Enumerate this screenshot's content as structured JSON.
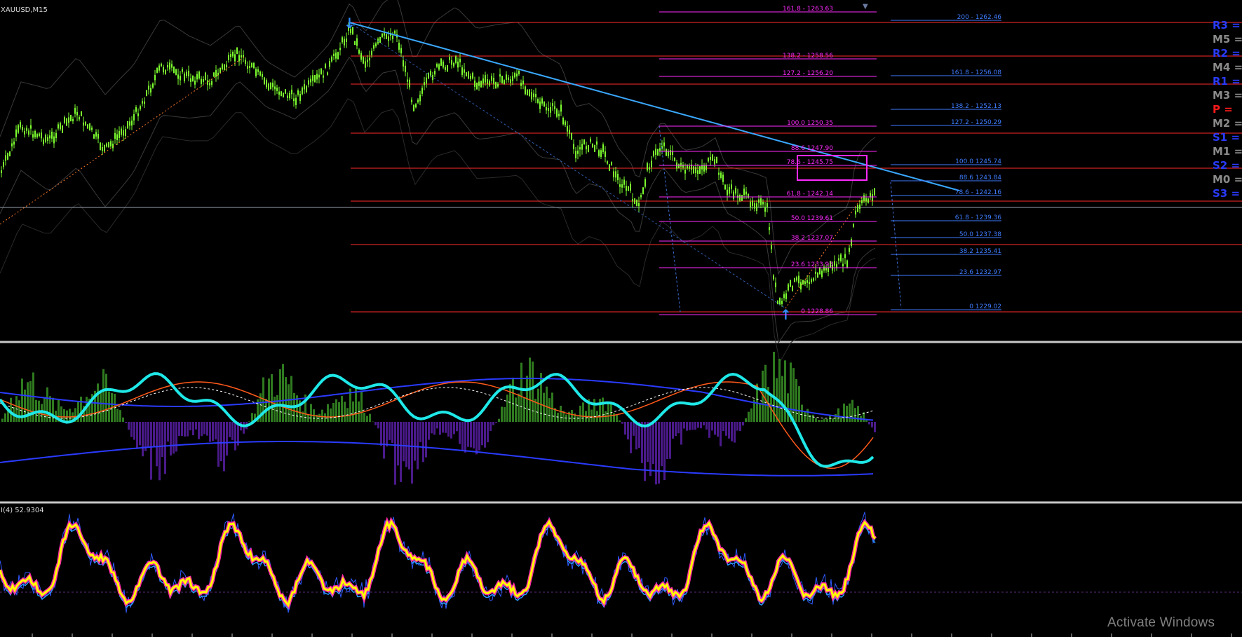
{
  "window": {
    "symbol_label": "XAUUSD,M15",
    "indicator_label": "I(4) 52.9304",
    "watermark": "Activate Windows"
  },
  "colors": {
    "background": "#000000",
    "candle": "#7CFF2F",
    "red_line": "#ff2a2a",
    "fib_magenta": "#ff2aff",
    "fib_blue": "#3f7dff",
    "trend_line": "#3aa8ff",
    "cyan": "#1fe8e8",
    "pivot_blue": "#2a3bff",
    "pivot_gray": "#8a8a8a",
    "pivot_red": "#ff1a1a",
    "hist_green": "#2f7a1f",
    "hist_purple": "#4a1a8a",
    "osc_yellow": "#ffff00",
    "osc_magenta": "#ff2aa8"
  },
  "fib_left": [
    {
      "label": "161.8 - 1263.63"
    },
    {
      "label": "138.2 - 1258.56"
    },
    {
      "label": "127.2 - 1256.20"
    },
    {
      "label": "100.0 1250.35"
    },
    {
      "label": "88.6 1247.90"
    },
    {
      "label": "78.6 - 1245.75"
    },
    {
      "label": "61.8 - 1242.14"
    },
    {
      "label": "50.0 1239.61"
    },
    {
      "label": "38.2 1237.07"
    },
    {
      "label": "23.6 1233.93"
    },
    {
      "label": "0 1228.86"
    }
  ],
  "fib_right": [
    {
      "label": "200 - 1262.46"
    },
    {
      "label": "161.8 - 1256.08"
    },
    {
      "label": "138.2 - 1252.13"
    },
    {
      "label": "127.2 - 1250.29"
    },
    {
      "label": "100.0 1245.74"
    },
    {
      "label": "88.6 1243.84"
    },
    {
      "label": "78.6 - 1242.16"
    },
    {
      "label": "61.8 - 1239.36"
    },
    {
      "label": "50.0 1237.38"
    },
    {
      "label": "38.2 1235.41"
    },
    {
      "label": "23.6 1232.97"
    },
    {
      "label": "0 1229.02"
    }
  ],
  "pivots": [
    {
      "label": "R3 = ",
      "color": "blue"
    },
    {
      "label": "M5 = ",
      "color": "gray"
    },
    {
      "label": "R2 = ",
      "color": "blue"
    },
    {
      "label": "M4 = ",
      "color": "gray"
    },
    {
      "label": "R1 = ",
      "color": "blue"
    },
    {
      "label": "M3 = ",
      "color": "gray"
    },
    {
      "label": "P  = ",
      "color": "red"
    },
    {
      "label": "M2 = ",
      "color": "gray"
    },
    {
      "label": "S1 = ",
      "color": "blue"
    },
    {
      "label": "M1 = ",
      "color": "gray"
    },
    {
      "label": "S2 = ",
      "color": "blue"
    },
    {
      "label": "M0 = ",
      "color": "gray"
    },
    {
      "label": "S3 = ",
      "color": "blue"
    }
  ]
}
